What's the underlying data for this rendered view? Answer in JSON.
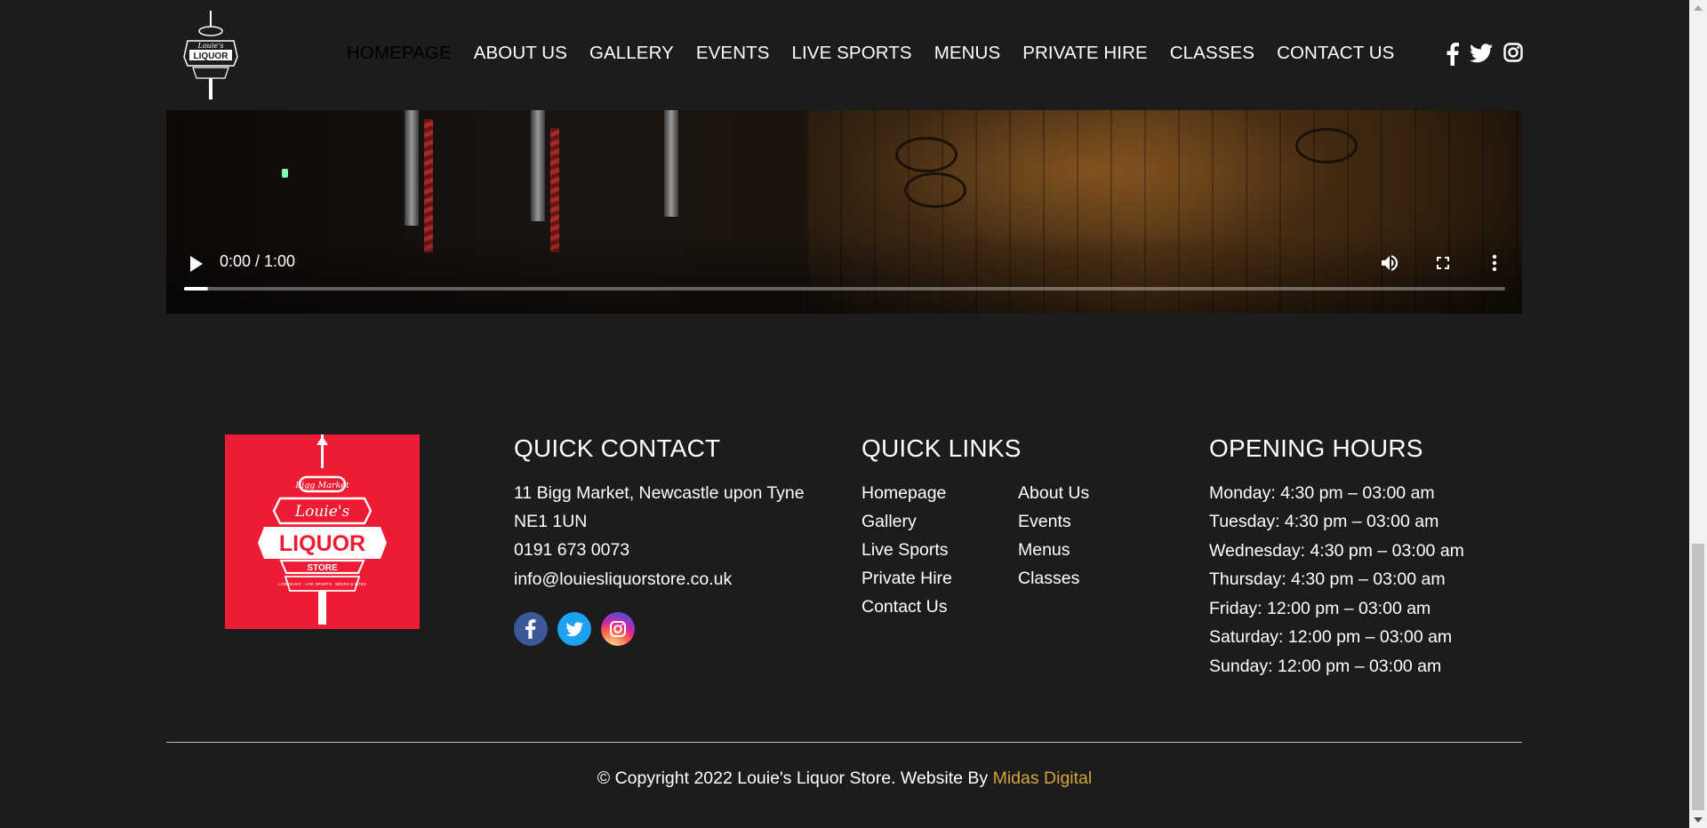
{
  "header": {
    "logo_icon": "louies-liquor-store-sign-logo",
    "nav": [
      {
        "label": "HOMEPAGE",
        "active": true
      },
      {
        "label": "ABOUT US",
        "active": false
      },
      {
        "label": "GALLERY",
        "active": false
      },
      {
        "label": "EVENTS",
        "active": false
      },
      {
        "label": "LIVE SPORTS",
        "active": false
      },
      {
        "label": "MENUS",
        "active": false
      },
      {
        "label": "PRIVATE HIRE",
        "active": false
      },
      {
        "label": "CLASSES",
        "active": false
      },
      {
        "label": "CONTACT US",
        "active": false
      }
    ],
    "social_icons": [
      "facebook-icon",
      "twitter-icon",
      "instagram-icon"
    ]
  },
  "video": {
    "time": "0:00 / 1:00",
    "progress": 0.018,
    "controls": [
      "play-icon",
      "volume-icon",
      "fullscreen-icon",
      "more-options-icon"
    ]
  },
  "footer": {
    "logo": {
      "background": "#ed1b33",
      "text_top": "Bigg Market",
      "text_script": "Louie's",
      "text_main": "LIQUOR",
      "text_sub": "STORE",
      "text_tagline": "LIVE MUSIC · LIVE SPORTS · BEERS & BITES"
    },
    "quick_contact": {
      "title": "QUICK CONTACT",
      "address_line1": "11 Bigg Market, Newcastle upon Tyne",
      "address_line2": "NE1 1UN",
      "phone": "0191 673 0073",
      "email": "info@louiesliquorstore.co.uk",
      "social_icons": [
        "facebook-icon",
        "twitter-icon",
        "instagram-icon"
      ]
    },
    "quick_links": {
      "title": "QUICK LINKS",
      "col1": [
        "Homepage",
        "Gallery",
        "Live Sports",
        "Private Hire",
        "Contact Us"
      ],
      "col2": [
        "About Us",
        "Events",
        "Menus",
        "Classes"
      ]
    },
    "opening_hours": {
      "title": "OPENING HOURS",
      "rows": [
        "Monday: 4:30 pm – 03:00 am",
        "Tuesday: 4:30 pm – 03:00 am",
        "Wednesday: 4:30 pm – 03:00 am",
        "Thursday: 4:30 pm – 03:00 am",
        "Friday: 12:00 pm – 03:00 am",
        "Saturday: 12:00 pm – 03:00 am",
        "Sunday: 12:00 pm – 03:00 am"
      ]
    },
    "copyright_prefix": "© Copyright 2022 Louie's Liquor Store. Website By ",
    "copyright_brand": "Midas Digital",
    "brand_color": "#d2a53c"
  }
}
